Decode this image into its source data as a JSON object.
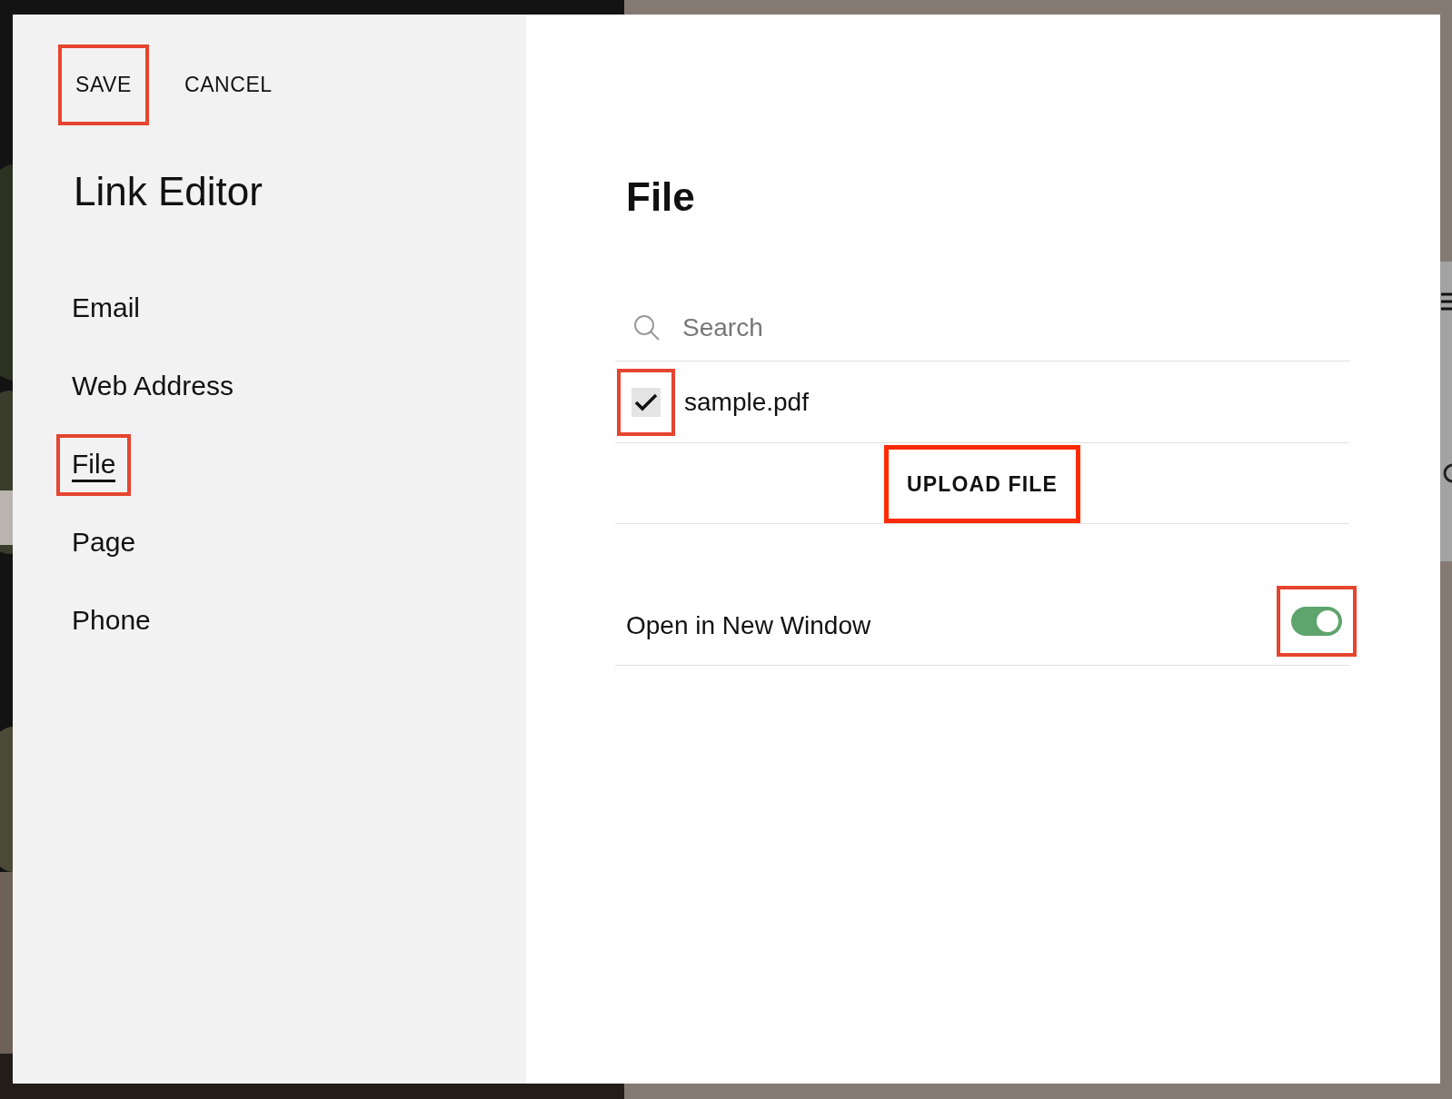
{
  "dialog": {
    "actions": [
      {
        "label": "SAVE",
        "highlighted": true
      },
      {
        "label": "CANCEL",
        "highlighted": false
      }
    ],
    "title": "Link Editor",
    "nav": [
      {
        "label": "Email",
        "selected": false,
        "highlighted": false
      },
      {
        "label": "Web Address",
        "selected": false,
        "highlighted": false
      },
      {
        "label": "File",
        "selected": true,
        "highlighted": true
      },
      {
        "label": "Page",
        "selected": false,
        "highlighted": false
      },
      {
        "label": "Phone",
        "selected": false,
        "highlighted": false
      }
    ],
    "panel": {
      "title": "File",
      "search": {
        "placeholder": "Search"
      },
      "files": [
        {
          "name": "sample.pdf",
          "checked": true,
          "highlighted": true
        }
      ],
      "upload_button": {
        "label": "UPLOAD FILE",
        "highlighted": true
      },
      "open_in_new_window": {
        "label": "Open in New Window",
        "on": true,
        "highlighted": true
      }
    }
  }
}
